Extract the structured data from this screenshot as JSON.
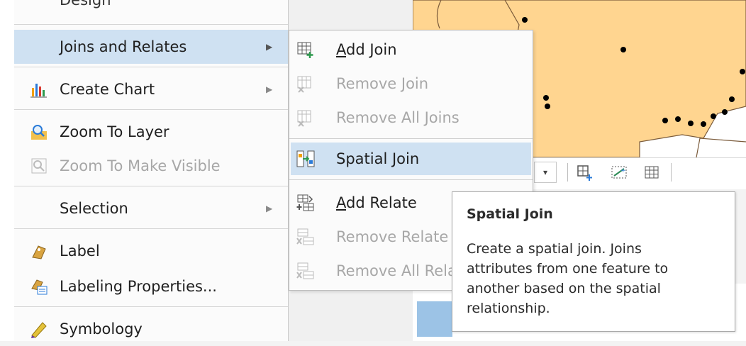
{
  "menu": {
    "partial_item": "Design",
    "items": [
      {
        "label": "Joins and Relates",
        "icon": "none",
        "has_submenu": true,
        "disabled": false,
        "highlighted": true
      },
      {
        "label": "Create Chart",
        "icon": "bar-chart-icon",
        "has_submenu": true,
        "disabled": false,
        "highlighted": false
      },
      {
        "label": "Zoom To Layer",
        "icon": "zoom-layer-icon",
        "has_submenu": false,
        "disabled": false,
        "highlighted": false
      },
      {
        "label": "Zoom To Make Visible",
        "icon": "zoom-visible-icon",
        "has_submenu": false,
        "disabled": true,
        "highlighted": false
      },
      {
        "label": "Selection",
        "icon": "none",
        "has_submenu": true,
        "disabled": false,
        "highlighted": false
      },
      {
        "label": "Label",
        "icon": "label-icon",
        "has_submenu": false,
        "disabled": false,
        "highlighted": false
      },
      {
        "label": "Labeling Properties...",
        "icon": "labeling-properties-icon",
        "has_submenu": false,
        "disabled": false,
        "highlighted": false
      },
      {
        "label": "Symbology",
        "icon": "symbology-icon",
        "has_submenu": false,
        "disabled": false,
        "highlighted": false
      }
    ]
  },
  "submenu": {
    "items": [
      {
        "accel": "A",
        "rest": "dd Join",
        "disabled": false,
        "highlighted": false
      },
      {
        "label": "Remove Join",
        "disabled": true
      },
      {
        "label": "Remove All Joins",
        "disabled": true
      },
      {
        "label": "Spatial Join",
        "disabled": false,
        "highlighted": true
      },
      {
        "accel": "A",
        "rest": "dd Relate",
        "disabled": false,
        "highlighted": false
      },
      {
        "label": "Remove Relate",
        "disabled": true
      },
      {
        "label": "Remove All Rela",
        "disabled": true
      }
    ]
  },
  "tooltip": {
    "title": "Spatial Join",
    "body": "Create a spatial join. Joins attributes from one feature to another based on the spatial relationship."
  },
  "colors": {
    "highlight": "#cfe1f2",
    "map_fill": "#ffd590",
    "disabled_text": "#a7a7a7"
  }
}
